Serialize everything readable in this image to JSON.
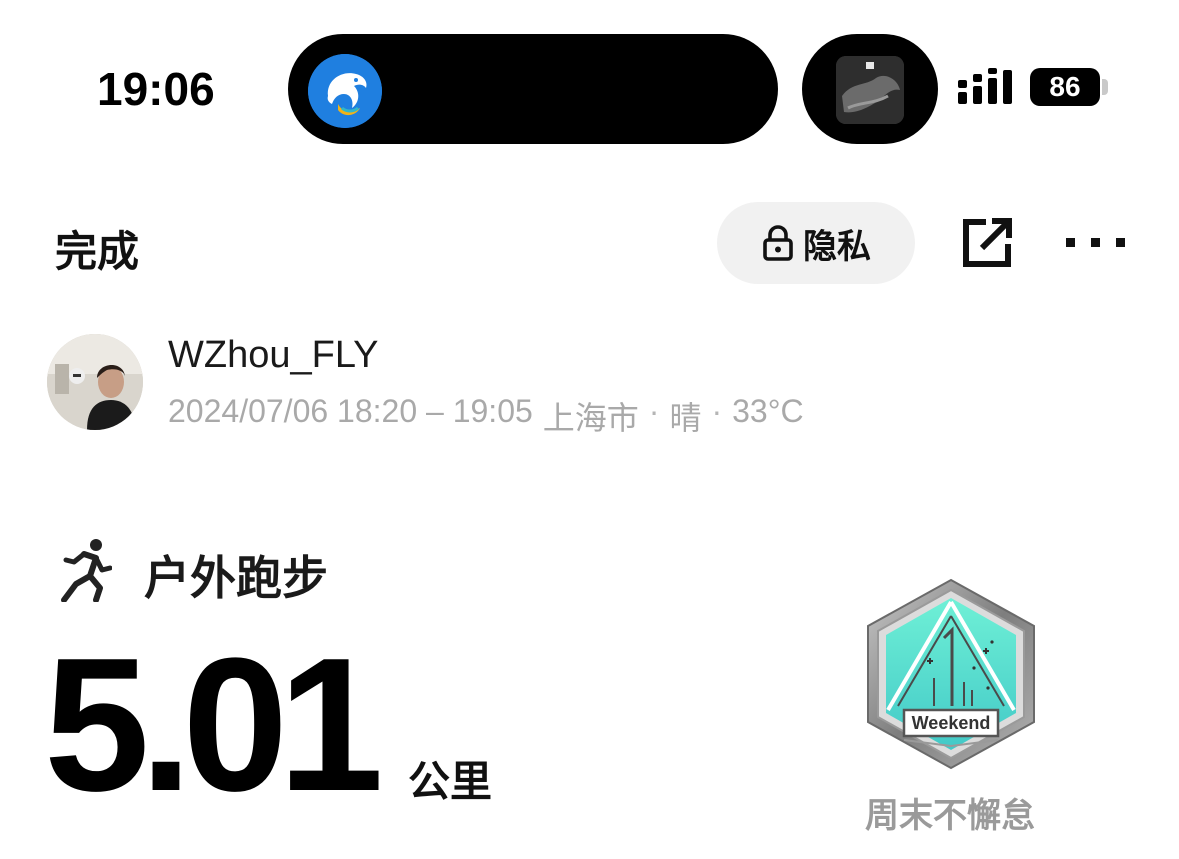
{
  "status_bar": {
    "time": "19:06",
    "battery_level": "86",
    "live_activity_app_icon": "dolphin-app-icon",
    "album_art_icon": "music-album-icon"
  },
  "header": {
    "done_label": "完成",
    "privacy_label": "隐私",
    "privacy_icon": "lock-icon",
    "share_icon": "share-external-icon",
    "more_icon": "more-dots-icon"
  },
  "user": {
    "username": "WZhou_FLY",
    "time_range": "2024/07/06 18:20 – 19:05",
    "location": "上海市",
    "separator": "·",
    "weather": "晴",
    "temperature": "33°C"
  },
  "workout": {
    "type_icon": "running-person-icon",
    "type_label": "户外跑步",
    "distance": "5.01",
    "distance_unit": "公里"
  },
  "badge": {
    "icon": "weekend-badge-icon",
    "badge_text": "Weekend",
    "name": "周末不懈怠"
  },
  "colors": {
    "island": "#000000",
    "app_icon_blue": "#1f7fe0",
    "badge_teal": "#5fe0c8",
    "badge_silver": "#8a8a8a",
    "meta_gray": "#a9a9a9"
  }
}
